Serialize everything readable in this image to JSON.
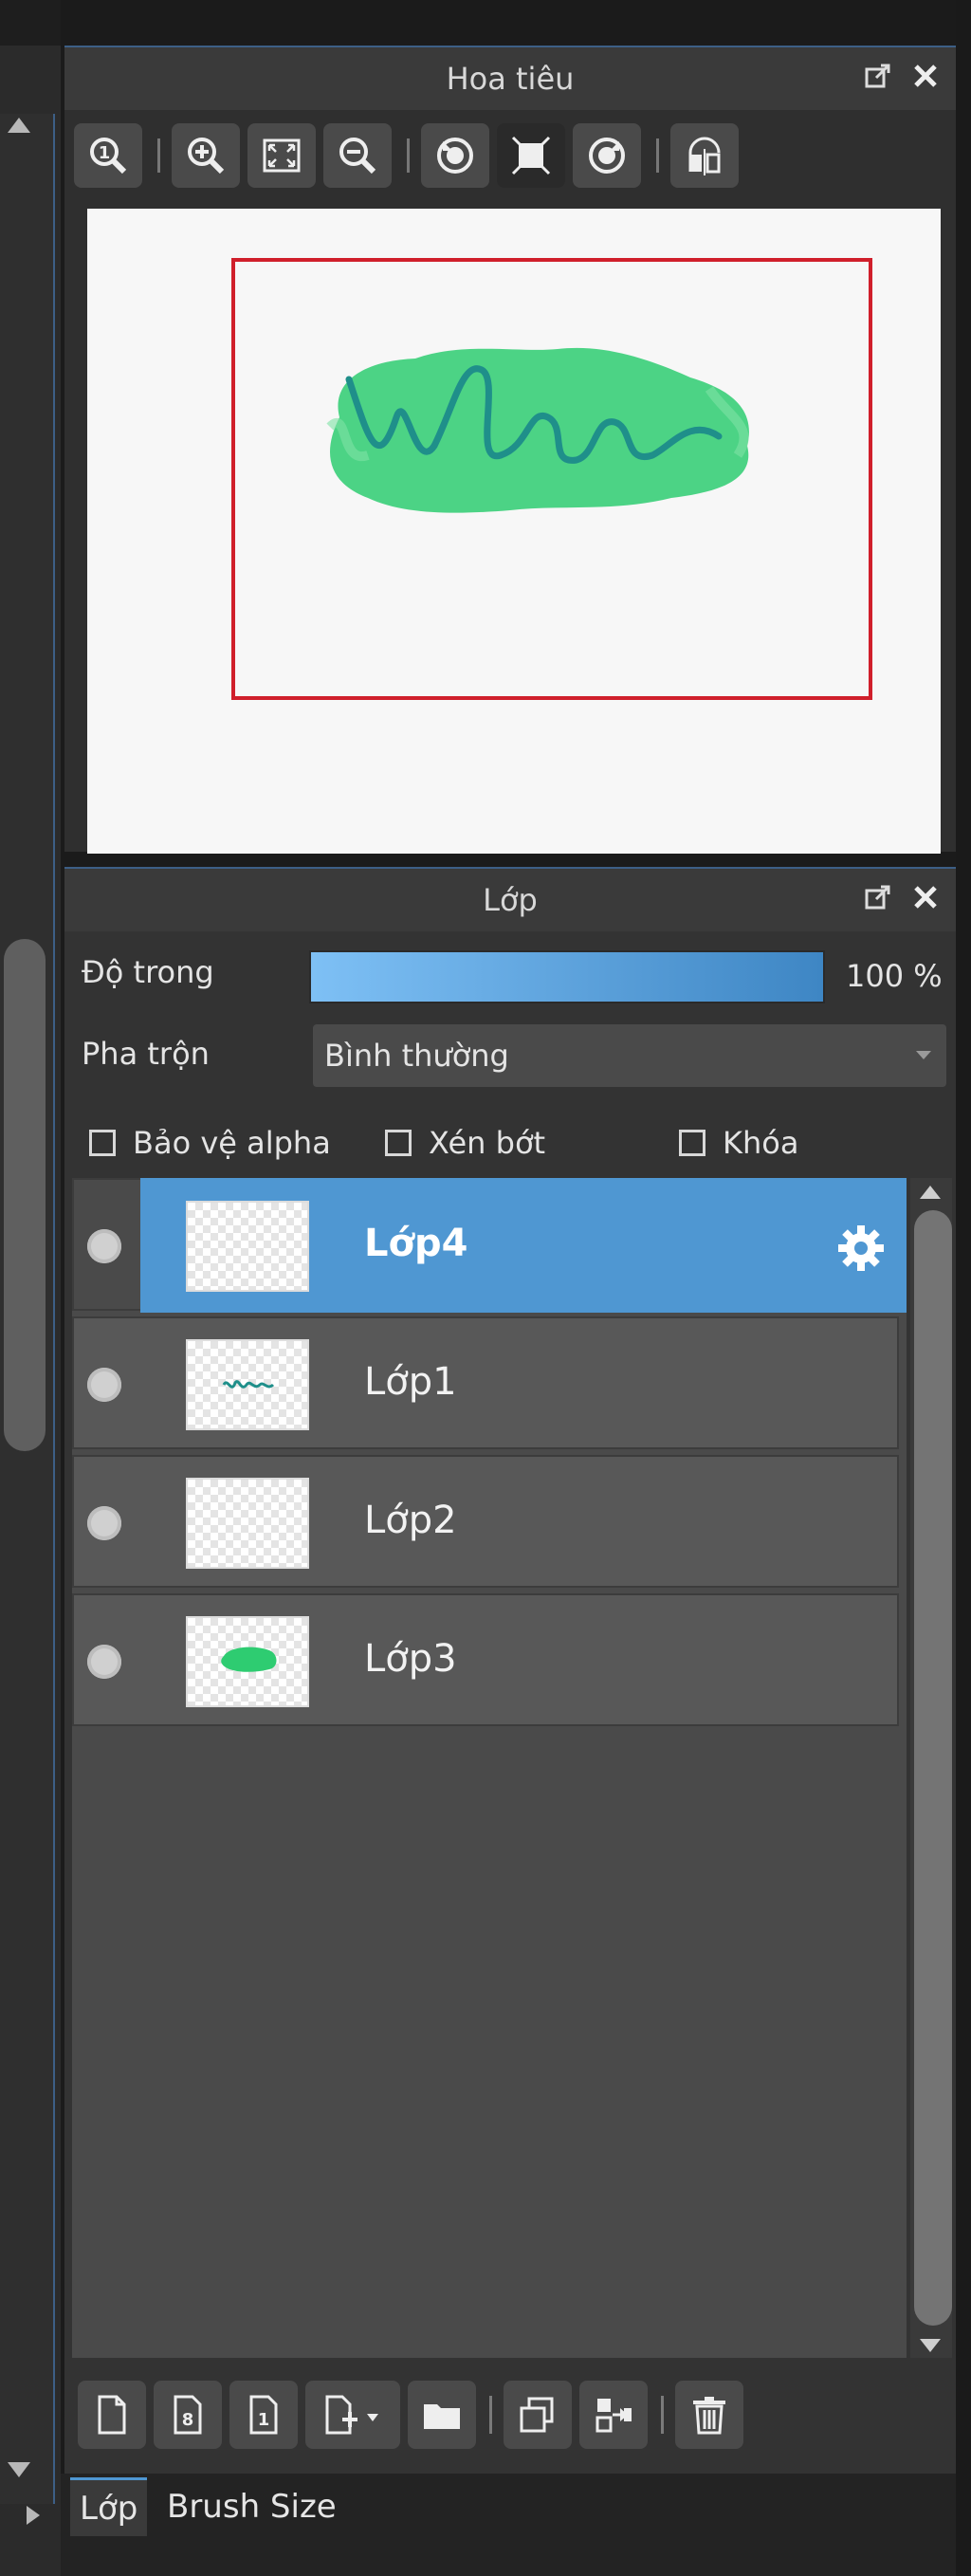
{
  "navigator": {
    "title": "Hoa tiêu",
    "toolbar": [
      "zoom-actual-icon",
      "zoom-in-icon",
      "fit-icon",
      "zoom-out-icon",
      "rotate-left-icon",
      "reset-view-icon",
      "rotate-right-icon",
      "flip-icon"
    ]
  },
  "layers_panel": {
    "title": "Lớp",
    "opacity_label": "Độ trong",
    "opacity_value": "100 %",
    "opacity_fraction": 1.0,
    "blend_label": "Pha trộn",
    "blend_value": "Bình thường",
    "checks": {
      "protect_alpha": "Bảo vệ alpha",
      "clipping": "Xén bớt",
      "lock": "Khóa"
    },
    "layers": [
      {
        "name": "Lớp4",
        "active": true
      },
      {
        "name": "Lớp1",
        "active": false
      },
      {
        "name": "Lớp2",
        "active": false
      },
      {
        "name": "Lớp3",
        "active": false
      }
    ]
  },
  "bottom_tabs": [
    "Lớp",
    "Brush Size"
  ],
  "colors": {
    "accent": "#4f97d2",
    "view_rect": "#d01f2b",
    "art_green": "#2ecc71",
    "art_teal": "#1f8f8a"
  }
}
